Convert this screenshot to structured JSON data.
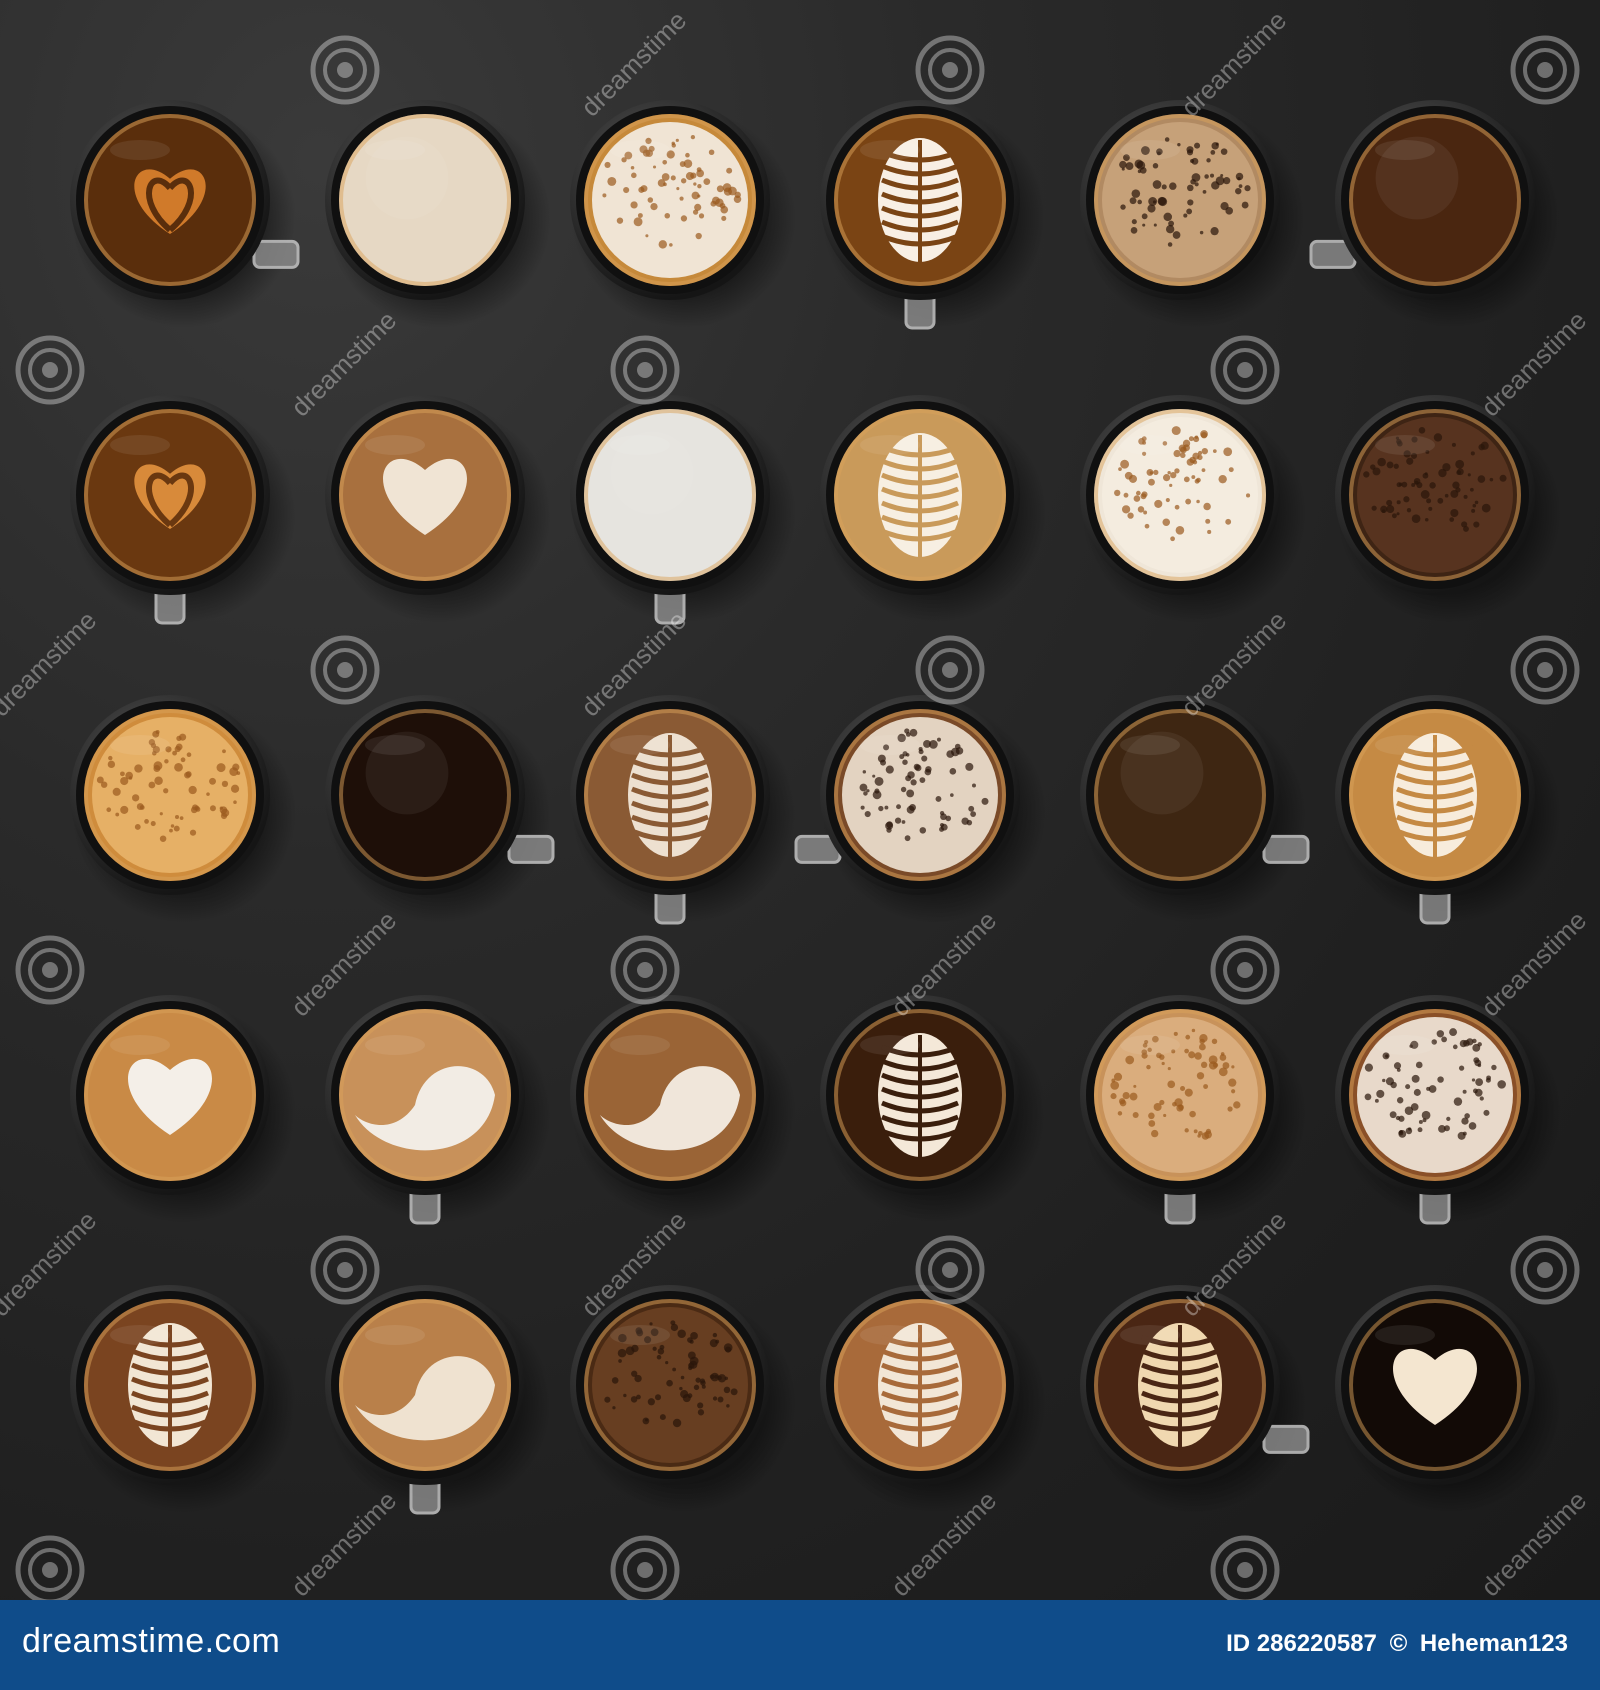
{
  "image": {
    "description_cells": [
      {
        "row": 0,
        "col": 0,
        "liquid": "#5a2e0c",
        "foam": "#d07a2a",
        "art": "heart-swirl",
        "handle": "right"
      },
      {
        "row": 0,
        "col": 1,
        "liquid": "#e6d8c4",
        "foam": "#efe4d4",
        "art": "none",
        "handle": "none"
      },
      {
        "row": 0,
        "col": 2,
        "liquid": "#c6893a",
        "foam": "#f4eee6",
        "art": "speckle",
        "handle": "none"
      },
      {
        "row": 0,
        "col": 3,
        "liquid": "#7a4414",
        "foam": "#f8efe4",
        "art": "leaf",
        "handle": "down"
      },
      {
        "row": 0,
        "col": 4,
        "liquid": "#b18a62",
        "foam": "#c9a37c",
        "art": "speckle-dark",
        "handle": "none"
      },
      {
        "row": 0,
        "col": 5,
        "liquid": "#4a2610",
        "foam": "#6b3a18",
        "art": "none",
        "handle": "left"
      },
      {
        "row": 1,
        "col": 0,
        "liquid": "#6a3810",
        "foam": "#d88a3a",
        "art": "heart-swirl",
        "handle": "down"
      },
      {
        "row": 1,
        "col": 1,
        "liquid": "#a8703e",
        "foam": "#f0e4d4",
        "art": "heart",
        "handle": "none"
      },
      {
        "row": 1,
        "col": 2,
        "liquid": "#e6e4df",
        "foam": "#f2f0ec",
        "art": "none",
        "handle": "down"
      },
      {
        "row": 1,
        "col": 3,
        "liquid": "#c99a5a",
        "foam": "#f7efe2",
        "art": "leaf",
        "handle": "none"
      },
      {
        "row": 1,
        "col": 4,
        "liquid": "#efe6d8",
        "foam": "#f4ece0",
        "art": "speckle",
        "handle": "none"
      },
      {
        "row": 1,
        "col": 5,
        "liquid": "#3e2414",
        "foam": "#5a3520",
        "art": "speckle-dark",
        "handle": "none"
      },
      {
        "row": 2,
        "col": 0,
        "liquid": "#cf8c3c",
        "foam": "#e8b46a",
        "art": "speckle",
        "handle": "none"
      },
      {
        "row": 2,
        "col": 1,
        "liquid": "#1e0f08",
        "foam": "#2c160a",
        "art": "none",
        "handle": "right"
      },
      {
        "row": 2,
        "col": 2,
        "liquid": "#8a5a34",
        "foam": "#ede0d0",
        "art": "leaf",
        "handle": "down"
      },
      {
        "row": 2,
        "col": 3,
        "liquid": "#7a4a28",
        "foam": "#eee2d2",
        "art": "speckle-dark",
        "handle": "left"
      },
      {
        "row": 2,
        "col": 4,
        "liquid": "#3e2612",
        "foam": "#5a3a1e",
        "art": "none",
        "handle": "right"
      },
      {
        "row": 2,
        "col": 5,
        "liquid": "#c58a44",
        "foam": "#f7ecdc",
        "art": "leaf",
        "handle": "down"
      },
      {
        "row": 3,
        "col": 0,
        "liquid": "#c98a46",
        "foam": "#f4efe8",
        "art": "heart",
        "handle": "none"
      },
      {
        "row": 3,
        "col": 1,
        "liquid": "#c8915a",
        "foam": "#f2ece4",
        "art": "swirl",
        "handle": "down"
      },
      {
        "row": 3,
        "col": 2,
        "liquid": "#9a6436",
        "foam": "#f0e6da",
        "art": "swirl",
        "handle": "none"
      },
      {
        "row": 3,
        "col": 3,
        "liquid": "#3a1e0c",
        "foam": "#f4e8d8",
        "art": "leaf",
        "handle": "none"
      },
      {
        "row": 3,
        "col": 4,
        "liquid": "#c8925a",
        "foam": "#dcb081",
        "art": "speckle",
        "handle": "down"
      },
      {
        "row": 3,
        "col": 5,
        "liquid": "#8a5028",
        "foam": "#f2e8dc",
        "art": "speckle-dark",
        "handle": "down"
      },
      {
        "row": 4,
        "col": 0,
        "liquid": "#7a4420",
        "foam": "#f2e6d4",
        "art": "leaf",
        "handle": "none"
      },
      {
        "row": 4,
        "col": 1,
        "liquid": "#b9804a",
        "foam": "#efe2d0",
        "art": "swirl",
        "handle": "down"
      },
      {
        "row": 4,
        "col": 2,
        "liquid": "#4a2a14",
        "foam": "#6a4022",
        "art": "speckle-dark",
        "handle": "none"
      },
      {
        "row": 4,
        "col": 3,
        "liquid": "#a86a3a",
        "foam": "#f2e6d6",
        "art": "leaf",
        "handle": "none"
      },
      {
        "row": 4,
        "col": 4,
        "liquid": "#4a2614",
        "foam": "#f0d8b0",
        "art": "leaf",
        "handle": "right"
      },
      {
        "row": 4,
        "col": 5,
        "liquid": "#120a06",
        "foam": "#f4e6d0",
        "art": "heart",
        "handle": "none"
      }
    ]
  },
  "watermark": {
    "logo": "dreamstime-spiral-icon",
    "text": "dreamstime"
  },
  "footer": {
    "brand": "dreamstime.com",
    "id_label": "ID 286220587",
    "copyright_symbol": "©",
    "author": "Heheman123",
    "background": "#0f4c8a"
  }
}
